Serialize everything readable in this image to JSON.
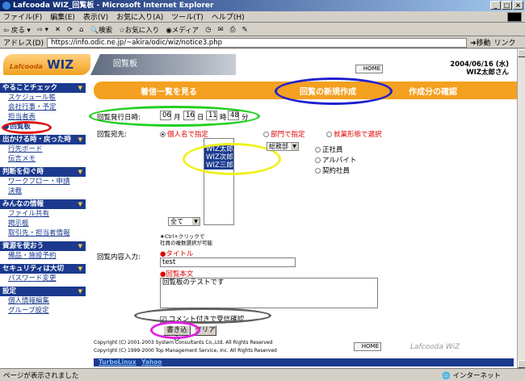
{
  "window": {
    "title": "Lafcooda WIZ_回覧板 - Microsoft Internet Explorer"
  },
  "menu": [
    "ファイル(F)",
    "編集(E)",
    "表示(V)",
    "お気に入り(A)",
    "ツール(T)",
    "ヘルプ(H)"
  ],
  "toolbar": {
    "back": "戻る",
    "search": "検索",
    "favorites": "お気に入り",
    "media": "メディア"
  },
  "address": {
    "label": "アドレス(D)",
    "url": "https://info.odic.ne.jp/~akira/odic/wiz/notice3.php",
    "go": "移動",
    "links": "リンク"
  },
  "status": {
    "text": "ページが表示されました",
    "zone": "インターネット"
  },
  "header": {
    "logo_small": "Lafcooda",
    "logo_big": "WIZ",
    "page_title": "回覧板",
    "home": "HOME",
    "date": "2004/06/16 (水)",
    "user": "WIZ太郎さん"
  },
  "sidebar": [
    {
      "head": "やることチェック",
      "items": [
        "スケジュール帳",
        "会社行事・予定",
        "担当者表",
        "回覧板"
      ]
    },
    {
      "head": "出かける時・戻った時",
      "items": [
        "行先ボード",
        "伝言メモ"
      ]
    },
    {
      "head": "判断を仰ぐ時",
      "items": [
        "ワークフロー・申請",
        "決裁"
      ]
    },
    {
      "head": "みんなの情報",
      "items": [
        "ファイル共有",
        "掲示板",
        "取引先・担当者情報"
      ]
    },
    {
      "head": "資源を使おう",
      "items": [
        "備品・施設予約"
      ]
    },
    {
      "head": "セキュリティは大切",
      "items": [
        "パスワード変更"
      ]
    },
    {
      "head": "設定",
      "items": [
        "個人情報編集",
        "グループ設定"
      ]
    }
  ],
  "tabs": [
    "着信一覧を見る",
    "回覧の新規作成",
    "作成分の確認"
  ],
  "form": {
    "date_label": "回覧発行日時:",
    "month": "06",
    "month_unit": "月",
    "day": "16",
    "day_unit": "日",
    "hour": "11",
    "hour_unit": "時",
    "minute": "48",
    "minute_unit": "分",
    "recipients_label": "回覧宛先:",
    "radio_person": "個人名で指定",
    "radio_dept": "部門で指定",
    "radio_employment": "就業形態で選択",
    "recipients": [
      "WIZ太郎",
      "WIZ次郎",
      "WIZ三郎"
    ],
    "filter_select": "全て",
    "dept_select": "総務部",
    "employment_types": [
      "正社員",
      "アルバイト",
      "契約社員"
    ],
    "ctrl_note_1": "★Ctrl+クリックで",
    "ctrl_note_2": "社員の複数選択が可能",
    "content_label": "回覧内容入力:",
    "title_label": "タイトル",
    "title_value": "test",
    "body_label": "回覧本文",
    "body_value": "回覧板のテストです",
    "confirm_label": "コメント付きで受信確認",
    "submit": "書き込み",
    "clear": "クリア"
  },
  "footer": {
    "copy1": "Copyright (C) 2001-2003 System Consultants Co.,Ltd. All Rights Reserved",
    "copy2": "Copyright (C) 1999-2000 Top Management Service, Inc. All Rights Reserved",
    "brand": "Lafcooda WiZ",
    "links": [
      "TurboLinux",
      "Yahoo"
    ]
  },
  "colors": {
    "nav_blue": "#1b3a8e",
    "accent_orange": "#f4a020",
    "required_red": "#e00000"
  }
}
